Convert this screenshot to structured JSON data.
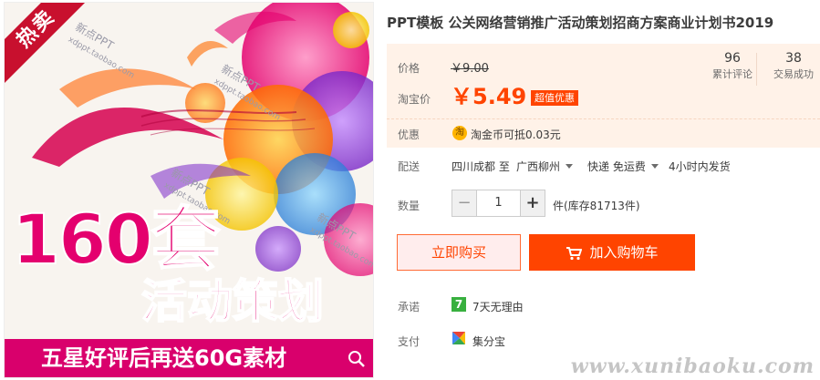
{
  "image": {
    "badge": "热卖",
    "watermark_text": "新点PPT",
    "watermark_url": "xdppt.taobao.com",
    "big_number": "160套",
    "sub_title": "活动策划",
    "banner": "五星好评后再送60G素材",
    "zoom_icon": "search-icon"
  },
  "title": "PPT模板 公关网络营销推广活动策划招商方案商业计划书2019",
  "price": {
    "label": "价格",
    "original": "￥9.00",
    "taobao_label": "淘宝价",
    "sale": "￥5.49",
    "badge": "超值优惠"
  },
  "stats": [
    {
      "num": "96",
      "cap": "累计评论"
    },
    {
      "num": "38",
      "cap": "交易成功"
    }
  ],
  "promo": {
    "label": "优惠",
    "icon": "淘",
    "text": "淘金币可抵0.03元"
  },
  "shipping": {
    "label": "配送",
    "from": "四川成都 至",
    "to": "广西柳州",
    "method": "快递 免运费",
    "dispatch": "4小时内发货"
  },
  "quantity": {
    "label": "数量",
    "minus": "−",
    "value": "1",
    "plus": "+",
    "stock": "件(库存81713件)"
  },
  "buttons": {
    "buy": "立即购买",
    "cart": "加入购物车"
  },
  "promise": {
    "label": "承诺",
    "icon": "7",
    "text": "7天无理由"
  },
  "payment": {
    "label": "支付",
    "text": "集分宝"
  },
  "site_watermark": "www.xunibaoku.com",
  "colors": {
    "accent": "#ff4400",
    "panel_bg": "#fff2e8",
    "image_magenta": "#e4006e",
    "badge_red": "#c8102e"
  }
}
